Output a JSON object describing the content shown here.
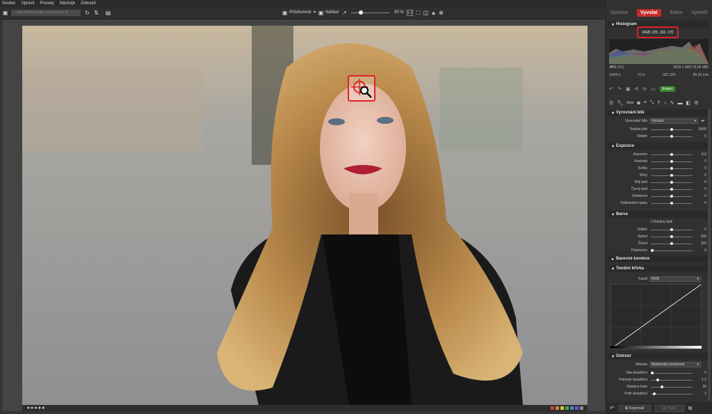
{
  "menu": [
    "Soubor",
    "Upravit",
    "Presety",
    "Nástroje",
    "Zobrazit"
  ],
  "toolbar": {
    "path": "...ulten liked fashion; universe inc fy",
    "mode_label": "Průzkumník",
    "preview_label": "Náhled",
    "zoom": "30 %"
  },
  "tabs": [
    "Správce",
    "Vyvolat",
    "Editor",
    "Vytvořit"
  ],
  "histogram": {
    "title": "Histogram",
    "rgb_readout": "RGB: 225, 193, 178"
  },
  "info": {
    "format": "JPG",
    "count": "(1/1)",
    "dimensions": "5629 x 3857 (8,06 MB)",
    "shutter": "1/400 s",
    "aperture": "F2,0",
    "iso": "ISO 320",
    "focal": "85.00 mm"
  },
  "actions": {
    "auto": "Auto",
    "export": "Export"
  },
  "white_balance": {
    "title": "Vyrovnání bílé",
    "preset_label": "Vyrovnání bílé",
    "preset_value": "Výchozí",
    "rows": [
      {
        "label": "Teplota bílé",
        "value": "5600",
        "pos": 0.5
      },
      {
        "label": "Odstín",
        "value": "0",
        "pos": 0.5
      }
    ]
  },
  "exposure": {
    "title": "Expozice",
    "rows": [
      {
        "label": "Expozice",
        "value": "0,0",
        "pos": 0.5
      },
      {
        "label": "Kontrast",
        "value": "0",
        "pos": 0.5
      },
      {
        "label": "Světla",
        "value": "0",
        "pos": 0.5
      },
      {
        "label": "Stíny",
        "value": "0",
        "pos": 0.5
      },
      {
        "label": "Bílý bod",
        "value": "0",
        "pos": 0.5
      },
      {
        "label": "Černý bod",
        "value": "0",
        "pos": 0.5
      },
      {
        "label": "Zřetelnost",
        "value": "0",
        "pos": 0.5
      },
      {
        "label": "Odstranění oparu",
        "value": "0",
        "pos": 0.5
      }
    ]
  },
  "color": {
    "title": "Barva",
    "checkbox_label": "Odstíny šedi",
    "rows": [
      {
        "label": "Odstín",
        "value": "0",
        "pos": 0.5
      },
      {
        "label": "Sytost",
        "value": "100",
        "pos": 0.5
      },
      {
        "label": "Živost",
        "value": "100",
        "pos": 0.5
      },
      {
        "label": "Polarizace",
        "value": "0",
        "pos": 0.0
      }
    ]
  },
  "color_correction": {
    "title": "Barevné korekce"
  },
  "tone_curve": {
    "title": "Tonální křivka",
    "channel_label": "Kanál",
    "channel_value": "RGB"
  },
  "sharpen": {
    "title": "Ostrost",
    "method_label": "Metoda",
    "method_value": "Maskování neostrosti",
    "rows": [
      {
        "label": "Síla doostření",
        "value": "0",
        "pos": 0.0
      },
      {
        "label": "Poloměr doostření",
        "value": "1,2",
        "pos": 0.15
      },
      {
        "label": "Detekce hran",
        "value": "25",
        "pos": 0.25
      },
      {
        "label": "Práh doostření",
        "value": "2",
        "pos": 0.05
      }
    ]
  },
  "bottom": {
    "copy": "Kopírovat",
    "paste": "Vložit"
  },
  "rating": {
    "stars": "★★★★★"
  }
}
